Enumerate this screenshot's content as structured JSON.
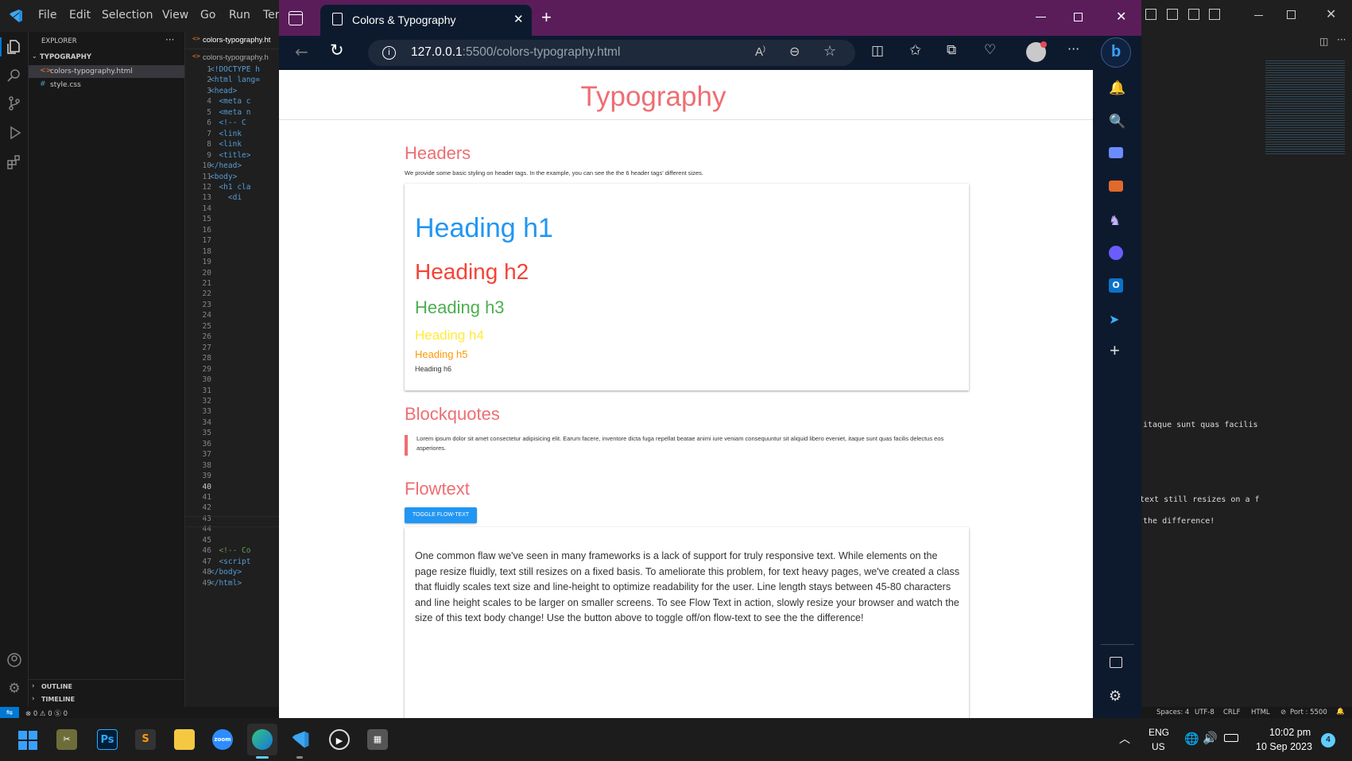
{
  "vscode": {
    "menu": [
      "File",
      "Edit",
      "Selection",
      "View",
      "Go",
      "Run",
      "Ter"
    ],
    "explorer_label": "EXPLORER",
    "folder_name": "TYPOGRAPHY",
    "files": [
      "colors-typography.html",
      "style.css"
    ],
    "editor_tab": "colors-typography.ht",
    "breadcrumb": "colors-typography.h",
    "code_lines": [
      "<!DOCTYPE h",
      "<html lang=",
      "<head>",
      "  <meta c",
      "  <meta n",
      "  <!-- C",
      "  <link",
      "  <link",
      "  <title>",
      "</head>",
      "<body>",
      "  <h1 cla",
      "    <di"
    ],
    "tail_lines": [
      "  <!-- Co",
      "  <script",
      "</body>",
      "</html>"
    ],
    "outline_label": "OUTLINE",
    "timeline_label": "TIMELINE",
    "right_pane_lines": [
      "itaque sunt quas facilis",
      "text still resizes on a f",
      "the difference!"
    ],
    "status_left": "⊗ 0 ⚠ 0   Ⓢ 0",
    "status_right": [
      "Spaces: 4",
      "UTF-8",
      "CRLF",
      "HTML",
      "Port : 5500"
    ]
  },
  "browser": {
    "tab_title": "Colors & Typography",
    "url_host": "127.0.0.1",
    "url_path": ":5500/colors-typography.html"
  },
  "page": {
    "title": "Typography",
    "headers_section": {
      "title": "Headers",
      "description": "We provide some basic styling on header tags. In the example, you can see the the 6 header tags' different sizes.",
      "h1": "Heading h1",
      "h2": "Heading h2",
      "h3": "Heading h3",
      "h4": "Heading h4",
      "h5": "Heading h5",
      "h6": "Heading h6"
    },
    "blockquotes_section": {
      "title": "Blockquotes",
      "quote": "Lorem ipsum dolor sit amet consectetur adipisicing elit. Earum facere, inventore dicta fuga repellat beatae animi iure veniam consequuntur sit aliquid libero eveniet, itaque sunt quas facilis delectus eos asperiores."
    },
    "flowtext_section": {
      "title": "Flowtext",
      "button_label": "TOGGLE FLOW-TEXT",
      "body": "One common flaw we've seen in many frameworks is a lack of support for truly responsive text. While elements on the page resize fluidly, text still resizes on a fixed basis. To ameliorate this problem, for text heavy pages, we've created a class that fluidly scales text size and line-height to optimize readability for the user. Line length stays between 45-80 characters and line height scales to be larger on smaller screens. To see Flow Text in action, slowly resize your browser and watch the size of this text body change! Use the button above to toggle off/on flow-text to see the the difference!"
    }
  },
  "taskbar": {
    "lang_1": "ENG",
    "lang_2": "US",
    "time": "10:02 pm",
    "date": "10 Sep 2023",
    "notification_count": "4"
  },
  "colors": {
    "h1": "#2196f3",
    "h2": "#f44336",
    "h3": "#4caf50",
    "h4": "#ffeb3b",
    "h5": "#ff9800",
    "accent": "#ee6e73"
  }
}
